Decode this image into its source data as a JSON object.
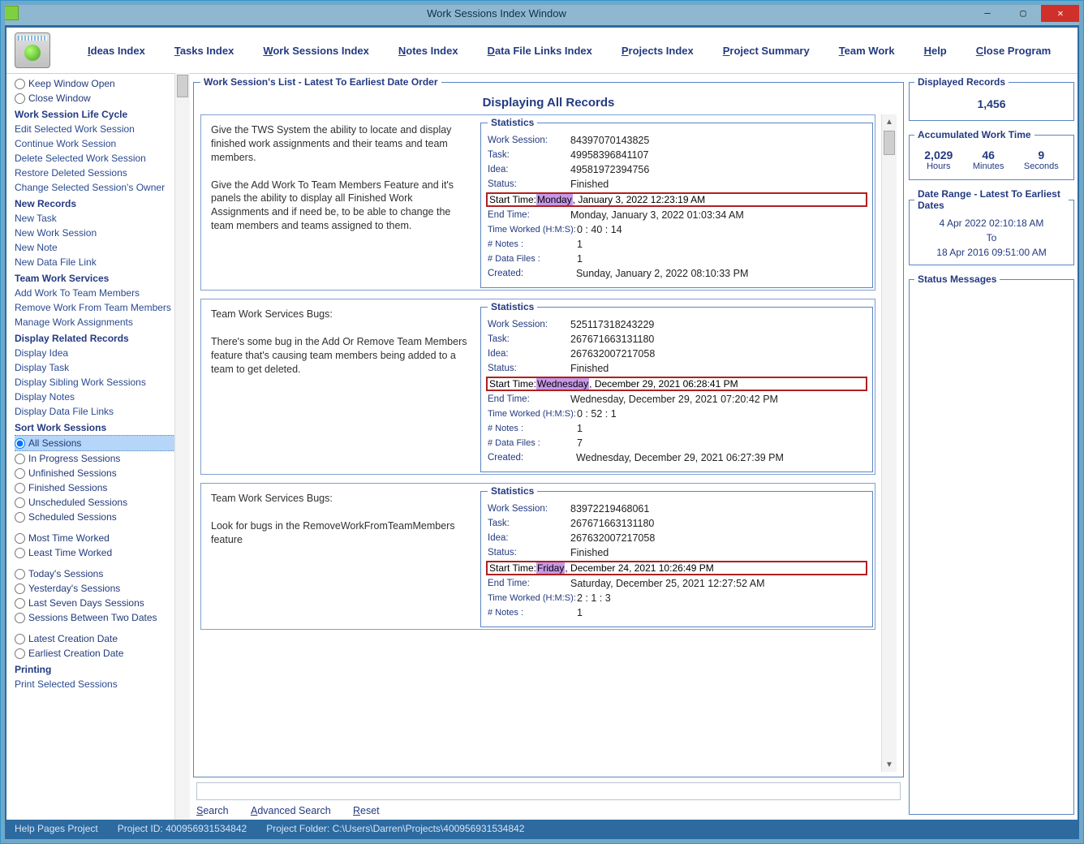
{
  "window": {
    "title": "Work Sessions Index Window"
  },
  "menu": {
    "ideas": "Ideas Index",
    "tasks": "Tasks Index",
    "ws": "Work Sessions Index",
    "notes": "Notes Index",
    "dfl": "Data File Links Index",
    "proj": "Projects Index",
    "psum": "Project Summary",
    "team": "Team Work",
    "help": "Help",
    "close": "Close Program"
  },
  "sidebar": {
    "keep": "Keep Window Open",
    "closew": "Close Window",
    "g1": "Work Session Life Cycle",
    "g1l": [
      "Edit Selected Work Session",
      "Continue Work Session",
      "Delete Selected Work Session",
      "Restore Deleted Sessions",
      "Change Selected Session's Owner"
    ],
    "g2": "New Records",
    "g2l": [
      "New Task",
      "New Work Session",
      "New Note",
      "New Data File Link"
    ],
    "g3": "Team Work Services",
    "g3l": [
      "Add Work To Team Members",
      "Remove Work From Team Members",
      "Manage Work Assignments"
    ],
    "g4": "Display Related Records",
    "g4l": [
      "Display Idea",
      "Display Task",
      "Display Sibling Work Sessions",
      "Display Notes",
      "Display Data File Links"
    ],
    "g5": "Sort Work Sessions",
    "sort": [
      "All Sessions",
      "In Progress Sessions",
      "Unfinished Sessions",
      "Finished Sessions",
      "Unscheduled Sessions",
      "Scheduled Sessions",
      "Most Time Worked",
      "Least Time Worked",
      "Today's Sessions",
      "Yesterday's Sessions",
      "Last Seven Days Sessions",
      "Sessions Between Two Dates",
      "Latest Creation Date",
      "Earliest Creation Date"
    ],
    "g6": "Printing",
    "g6l": [
      "Print Selected Sessions"
    ]
  },
  "listTitle": "Work Session's List - Latest To Earliest Date Order",
  "displaying": "Displaying All Records",
  "labels": {
    "ws": "Work Session:",
    "task": "Task:",
    "idea": "Idea:",
    "status": "Status:",
    "start": "Start Time:",
    "end": "End Time:",
    "tw": "Time Worked (H:M:S):",
    "notes": "# Notes :",
    "df": "# Data Files :",
    "created": "Created:",
    "stats": "Statistics"
  },
  "sessions": [
    {
      "desc1": "Give the TWS System the ability to locate and display finished work assignments and their teams and team members.",
      "desc2": "Give the Add Work To Team Members Feature and it's panels the ability to display all Finished Work Assignments and if need be, to be able to change the team members and teams assigned to them.",
      "ws": "84397070143825",
      "task": "49958396841107",
      "idea": "49581972394756",
      "status": "Finished",
      "start_day": "Monday",
      "start_rest": ", January 3, 2022   12:23:19 AM",
      "end": "Monday, January 3, 2022   01:03:34 AM",
      "tw": "0   :  40  :  14",
      "notes": "1",
      "df": "1",
      "created": "Sunday, January 2, 2022   08:10:33 PM"
    },
    {
      "desc1": "Team Work Services Bugs:",
      "desc2": "There's some bug in the Add Or Remove Team Members feature that's causing team members being added to a team to get deleted.",
      "ws": "525117318243229",
      "task": "267671663131180",
      "idea": "267632007217058",
      "status": "Finished",
      "start_day": "Wednesday",
      "start_rest": ", December 29, 2021   06:28:41 PM",
      "end": "Wednesday, December 29, 2021   07:20:42 PM",
      "tw": "0   :  52   :   1",
      "notes": "1",
      "df": "7",
      "created": "Wednesday, December 29, 2021   06:27:39 PM"
    },
    {
      "desc1": "Team Work Services Bugs:",
      "desc2": "Look for bugs in the RemoveWorkFromTeamMembers feature",
      "ws": "83972219468061",
      "task": "267671663131180",
      "idea": "267632007217058",
      "status": "Finished",
      "start_day": "Friday",
      "start_rest": ", December 24, 2021   10:26:49 PM",
      "end": "Saturday, December 25, 2021   12:27:52 AM",
      "tw": "2   :   1   :   3",
      "notes": "1",
      "df": "",
      "created": ""
    }
  ],
  "right": {
    "dispTitle": "Displayed Records",
    "dispVal": "1,456",
    "accTitle": "Accumulated Work Time",
    "h": "2,029",
    "m": "46",
    "s": "9",
    "hl": "Hours",
    "ml": "Minutes",
    "sl": "Seconds",
    "drTitle": "Date Range - Latest To Earliest Dates",
    "dr1": "4 Apr 2022  02:10:18 AM",
    "drTo": "To",
    "dr2": "18 Apr 2016  09:51:00 AM",
    "smTitle": "Status Messages"
  },
  "search": {
    "s": "Search",
    "a": "Advanced Search",
    "r": "Reset"
  },
  "status": {
    "p1": "Help Pages Project",
    "p2": "Project ID: 400956931534842",
    "p3": "Project Folder: C:\\Users\\Darren\\Projects\\400956931534842"
  }
}
